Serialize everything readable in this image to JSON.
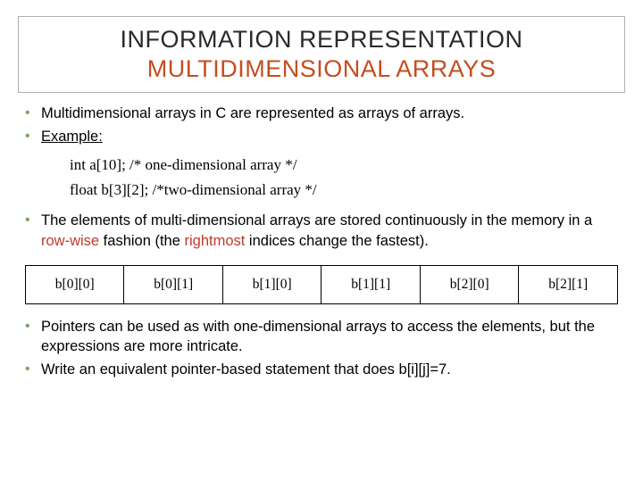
{
  "title": {
    "line1": "INFORMATION REPRESENTATION",
    "line2": "MULTIDIMENSIONAL ARRAYS"
  },
  "bullets_top": {
    "b1": "Multidimensional arrays in C are represented as arrays of arrays.",
    "b2": "Example:"
  },
  "code": {
    "l1": "int a[10]; /* one-dimensional array */",
    "l2": "float b[3][2]; /*two-dimensional array */"
  },
  "bullet_mid": {
    "pre": "The elements of multi-dimensional arrays are stored continuously in the memory in a ",
    "rowwise": "row-wise",
    "mid": " fashion (the ",
    "rightmost": "rightmost",
    "post": " indices change the fastest)."
  },
  "table": {
    "c0": "b[0][0]",
    "c1": "b[0][1]",
    "c2": "b[1][0]",
    "c3": "b[1][1]",
    "c4": "b[2][0]",
    "c5": "b[2][1]"
  },
  "bullets_bottom": {
    "b1": "Pointers can be used as with one-dimensional arrays to access the elements, but the expressions are more intricate.",
    "b2": "Write an equivalent pointer-based statement that does b[i][j]=7."
  }
}
